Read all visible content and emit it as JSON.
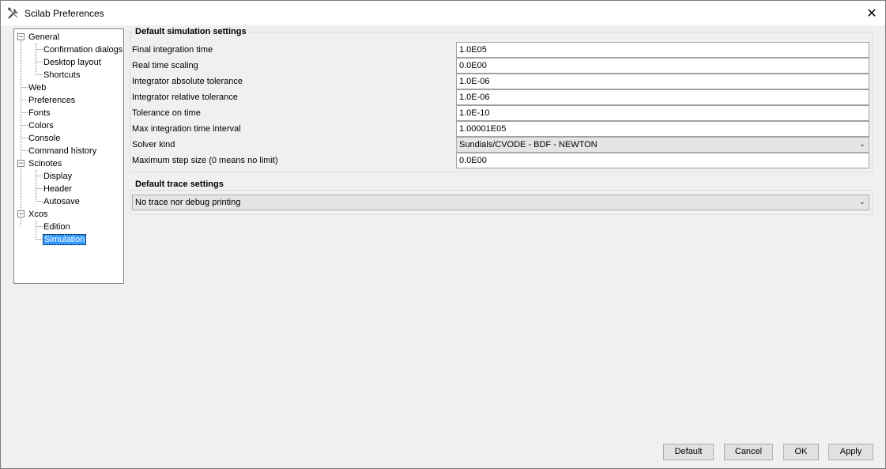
{
  "window": {
    "title": "Scilab Preferences",
    "icons": {
      "app": "tools-icon",
      "close": "close-icon"
    }
  },
  "tree": {
    "items": [
      {
        "label": "General",
        "level": 0,
        "expanded": true
      },
      {
        "label": "Confirmation dialogs",
        "level": 1
      },
      {
        "label": "Desktop layout",
        "level": 1
      },
      {
        "label": "Shortcuts",
        "level": 1
      },
      {
        "label": "Web",
        "level": 0
      },
      {
        "label": "Preferences",
        "level": 0
      },
      {
        "label": "Fonts",
        "level": 0
      },
      {
        "label": "Colors",
        "level": 0
      },
      {
        "label": "Console",
        "level": 0
      },
      {
        "label": "Command history",
        "level": 0
      },
      {
        "label": "Scinotes",
        "level": 0,
        "expanded": true
      },
      {
        "label": "Display",
        "level": 1
      },
      {
        "label": "Header",
        "level": 1
      },
      {
        "label": "Autosave",
        "level": 1
      },
      {
        "label": "Xcos",
        "level": 0,
        "expanded": true
      },
      {
        "label": "Edition",
        "level": 1
      },
      {
        "label": "Simulation",
        "level": 1,
        "selected": true
      }
    ]
  },
  "simulation": {
    "title": "Default simulation settings",
    "rows": [
      {
        "label": "Final integration time",
        "value": "1.0E05"
      },
      {
        "label": "Real time scaling",
        "value": "0.0E00"
      },
      {
        "label": "Integrator absolute tolerance",
        "value": "1.0E-06"
      },
      {
        "label": "Integrator relative tolerance",
        "value": "1.0E-06"
      },
      {
        "label": "Tolerance on time",
        "value": "1.0E-10"
      },
      {
        "label": "Max integration time interval",
        "value": "1.00001E05"
      },
      {
        "label": "Solver kind",
        "value": "Sundials/CVODE - BDF - NEWTON"
      },
      {
        "label": "Maximum step size (0 means no limit)",
        "value": "0.0E00"
      }
    ]
  },
  "trace": {
    "title": "Default trace settings",
    "value": "No trace nor debug printing"
  },
  "buttons": {
    "default": "Default",
    "cancel": "Cancel",
    "ok": "OK",
    "apply": "Apply"
  },
  "glyphs": {
    "expanded": "−",
    "dropdown": "⌄",
    "close": "✕"
  }
}
